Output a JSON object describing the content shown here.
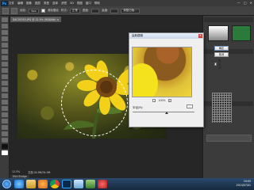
{
  "app": {
    "logo_text": "Ps",
    "window_controls": [
      "—",
      "□",
      "✕"
    ]
  },
  "menubar": {
    "items": [
      "文件",
      "编辑",
      "图像",
      "图层",
      "类型",
      "选择",
      "滤镜",
      "3D",
      "视图",
      "窗口",
      "帮助"
    ]
  },
  "options": {
    "feather_label": "羽化:",
    "feather_value": "0px",
    "antialias_label": "消除锯齿",
    "style_label": "样式:",
    "style_value": "正常",
    "width_label": "宽度:",
    "height_label": "高度:",
    "refine_label": "调整边缘..."
  },
  "document": {
    "tab_title": "DSC05353.JPG @ 12.5% (RGB/8#) ×"
  },
  "status": {
    "zoom": "12.5%",
    "doc_size": "文档:34.9M/34.9M"
  },
  "mini_bridge": {
    "label": "Mini Bridge"
  },
  "dialog": {
    "title": "高斯模糊",
    "close_glyph": "✕",
    "ok_label": "确定",
    "cancel_label": "取消",
    "preview_label": "预览(P)",
    "zoom_out": "−",
    "zoom_in": "+",
    "zoom_value": "100%",
    "amount_label": "半径(R):",
    "amount_value": "8",
    "amount_fraction": 0.55
  },
  "taskbar": {
    "time": "19:05",
    "date": "2014/07/01"
  },
  "colors": {
    "accent": "#31a8ff",
    "selection": "#ffffff",
    "taskbar": "#2b4a6b"
  }
}
